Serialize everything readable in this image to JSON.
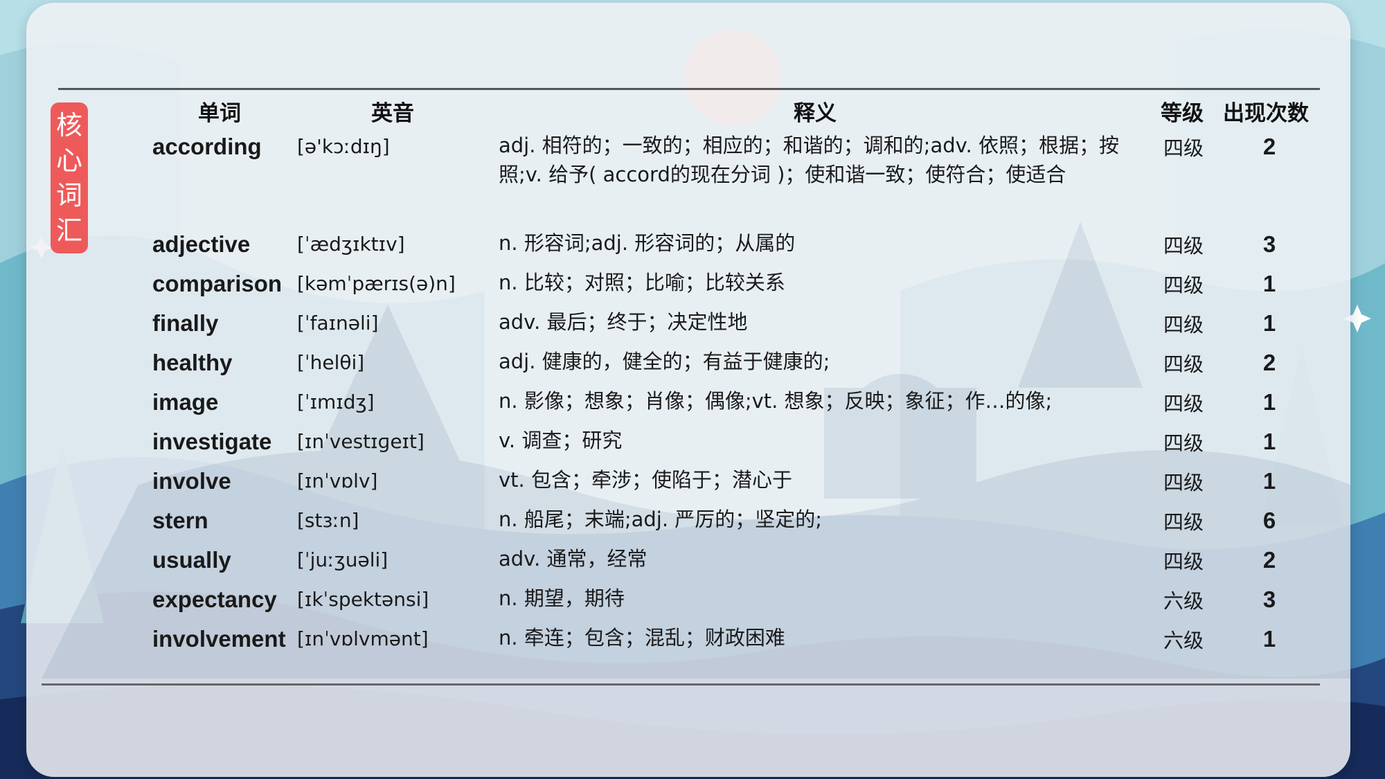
{
  "side_tag": [
    "核",
    "心",
    "词",
    "汇"
  ],
  "headers": {
    "word": "单词",
    "phonetic": "英音",
    "definition": "释义",
    "level": "等级",
    "count": "出现次数"
  },
  "rows": [
    {
      "word": "according",
      "phonetic": "[ə'kɔːdɪŋ]",
      "definition": "adj. 相符的；一致的；相应的；和谐的；调和的;adv. 依照；根据；按照;v. 给予( accord的现在分词 )；使和谐一致；使符合；使适合",
      "level": "四级",
      "count": "2"
    },
    {
      "word": "adjective",
      "phonetic": "[ˈædʒɪktɪv]",
      "definition": "n. 形容词;adj. 形容词的；从属的",
      "level": "四级",
      "count": "3"
    },
    {
      "word": "comparison",
      "phonetic": "[kəmˈpærɪs(ə)n]",
      "definition": "n. 比较；对照；比喻；比较关系",
      "level": "四级",
      "count": "1"
    },
    {
      "word": "finally",
      "phonetic": "[ˈfaɪnəli]",
      "definition": "adv. 最后；终于；决定性地",
      "level": "四级",
      "count": "1"
    },
    {
      "word": "healthy",
      "phonetic": "[ˈhelθi]",
      "definition": "adj. 健康的，健全的；有益于健康的;",
      "level": "四级",
      "count": "2"
    },
    {
      "word": "image",
      "phonetic": "[ˈɪmɪdʒ]",
      "definition": "n. 影像；想象；肖像；偶像;vt. 想象；反映；象征；作…的像;",
      "level": "四级",
      "count": "1"
    },
    {
      "word": "investigate",
      "phonetic": "[ɪnˈvestɪɡeɪt]",
      "definition": "v. 调查；研究",
      "level": "四级",
      "count": "1"
    },
    {
      "word": "involve",
      "phonetic": "[ɪnˈvɒlv]",
      "definition": "vt. 包含；牵涉；使陷于；潜心于",
      "level": "四级",
      "count": "1"
    },
    {
      "word": "stern",
      "phonetic": "[stɜːn]",
      "definition": "n. 船尾；末端;adj. 严厉的；坚定的;",
      "level": "四级",
      "count": "6"
    },
    {
      "word": "usually",
      "phonetic": "[ˈjuːʒuəli]",
      "definition": "adv. 通常，经常",
      "level": "四级",
      "count": "2"
    },
    {
      "word": "expectancy",
      "phonetic": "[ɪkˈspektənsi]",
      "definition": "n. 期望，期待",
      "level": "六级",
      "count": "3"
    },
    {
      "word": "involvement",
      "phonetic": "[ɪnˈvɒlvmənt]",
      "definition": "n. 牵连；包含；混乱；财政困难",
      "level": "六级",
      "count": "1"
    }
  ]
}
